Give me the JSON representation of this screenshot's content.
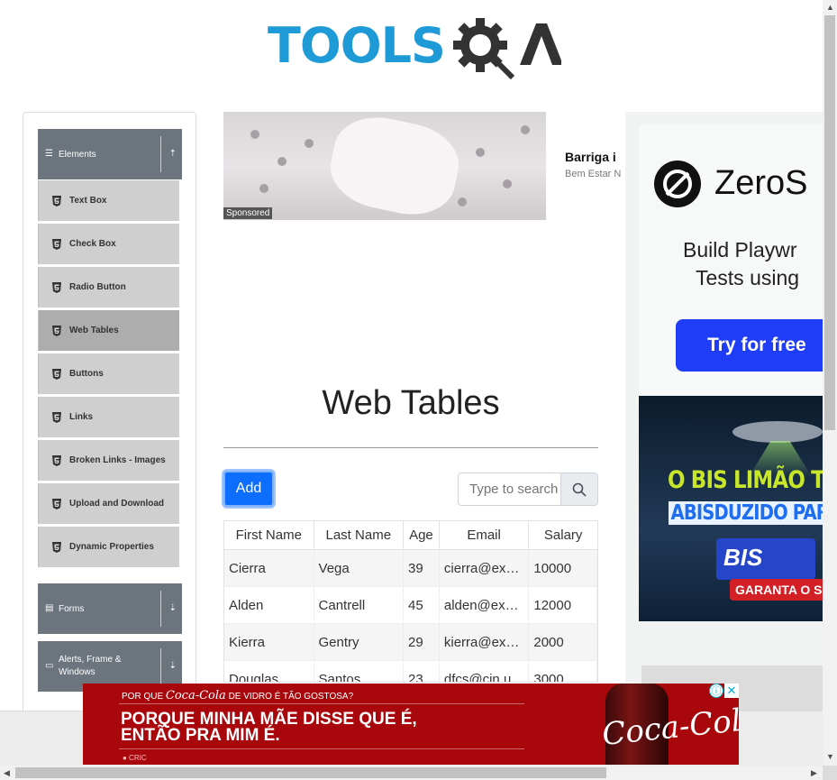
{
  "header": {
    "logo_text": "TOOLS",
    "logo_qa": "QA"
  },
  "sidebar": {
    "elements_group": "Elements",
    "items": [
      {
        "label": "Text Box",
        "active": false
      },
      {
        "label": "Check Box",
        "active": false
      },
      {
        "label": "Radio Button",
        "active": false
      },
      {
        "label": "Web Tables",
        "active": true
      },
      {
        "label": "Buttons",
        "active": false
      },
      {
        "label": "Links",
        "active": false
      },
      {
        "label": "Broken Links - Images",
        "active": false
      },
      {
        "label": "Upload and Download",
        "active": false
      },
      {
        "label": "Dynamic Properties",
        "active": false
      }
    ],
    "forms_group": "Forms",
    "alerts_group": "Alerts, Frame & Windows"
  },
  "top_ad": {
    "sponsored": "Sponsored",
    "title": "Barriga i",
    "subtitle": "Bem Estar N"
  },
  "main": {
    "title": "Web Tables",
    "add_label": "Add",
    "search_placeholder": "Type to search"
  },
  "table": {
    "headers": [
      "First Name",
      "Last Name",
      "Age",
      "Email",
      "Salary"
    ],
    "rows": [
      [
        "Cierra",
        "Vega",
        "39",
        "cierra@ex…",
        "10000"
      ],
      [
        "Alden",
        "Cantrell",
        "45",
        "alden@ex…",
        "12000"
      ],
      [
        "Kierra",
        "Gentry",
        "29",
        "kierra@ex…",
        "2000"
      ],
      [
        "Douglas",
        "Santos",
        "23",
        "dfcs@cin.u…",
        "3000"
      ]
    ]
  },
  "right_ad": {
    "brand": "ZeroS",
    "line1": "Build Playwr",
    "line2": "Tests using",
    "cta": "Try for free",
    "bis_line1": "O BIS LIMÃO TÁ S",
    "bis_line2": "ABISDUZIDO PARA S",
    "bis_pack": "BIS",
    "bis_cta": "GARANTA O SEU"
  },
  "bottom_ad": {
    "small_prefix": "POR QUE",
    "small_brand": "Coca-Cola",
    "small_suffix": "DE VIDRO É TÃO GOSTOSA?",
    "line1": "PORQUE MINHA MÃE DISSE QUE É,",
    "line2": "ENTÃO PRA MIM É.",
    "logo": "Coca-Cola",
    "footer": "● CRIC",
    "adchoice": "ⓘ",
    "close": "✕"
  },
  "colors": {
    "logo_blue": "#1e9ad6",
    "sidebar_header": "#6c757d",
    "sidebar_item": "#cfcfcf",
    "sidebar_active": "#adadad",
    "primary": "#0d6efd",
    "coke_red": "#a8070c",
    "zero_btn": "#1f3df7"
  }
}
